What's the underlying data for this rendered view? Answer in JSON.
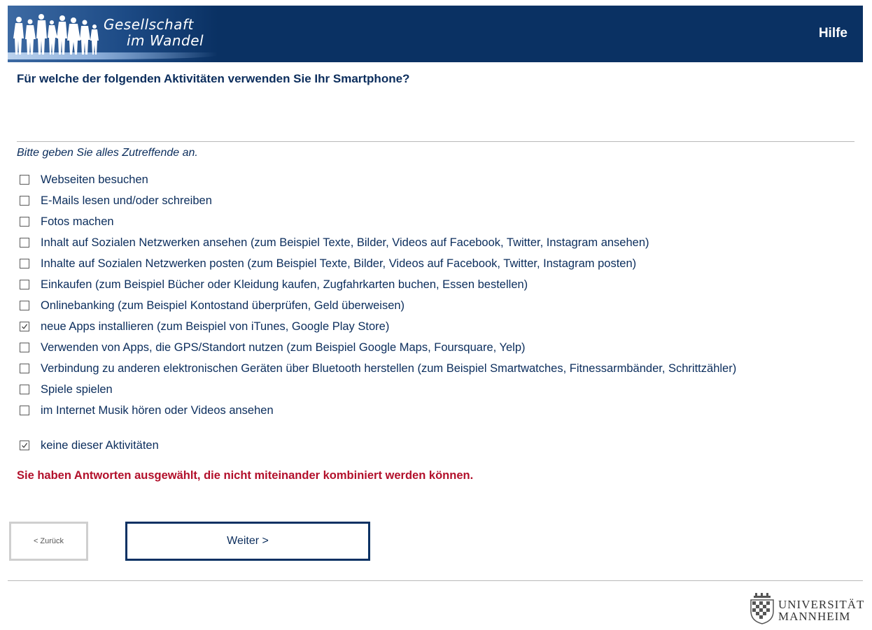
{
  "header": {
    "logo_line1": "Gesellschaft",
    "logo_line2": "im Wandel",
    "help_label": "Hilfe",
    "background_color": "#0a3163"
  },
  "question": {
    "title": "Für welche der folgenden Aktivitäten verwenden Sie Ihr Smartphone?",
    "instruction": "Bitte geben Sie alles Zutreffende an."
  },
  "options": [
    {
      "label": "Webseiten besuchen",
      "checked": false
    },
    {
      "label": "E-Mails lesen und/oder schreiben",
      "checked": false
    },
    {
      "label": "Fotos machen",
      "checked": false
    },
    {
      "label": "Inhalt auf Sozialen Netzwerken ansehen (zum Beispiel Texte, Bilder, Videos auf Facebook, Twitter, Instagram ansehen)",
      "checked": false
    },
    {
      "label": "Inhalte auf Sozialen Netzwerken posten (zum Beispiel Texte, Bilder, Videos auf Facebook, Twitter, Instagram posten)",
      "checked": false
    },
    {
      "label": "Einkaufen (zum Beispiel Bücher oder Kleidung kaufen, Zugfahrkarten buchen, Essen bestellen)",
      "checked": false
    },
    {
      "label": "Onlinebanking (zum Beispiel Kontostand überprüfen, Geld überweisen)",
      "checked": false
    },
    {
      "label": "neue Apps installieren (zum Beispiel von iTunes, Google Play Store)",
      "checked": true
    },
    {
      "label": "Verwenden von Apps, die GPS/Standort nutzen (zum Beispiel Google Maps, Foursquare, Yelp)",
      "checked": false
    },
    {
      "label": "Verbindung zu anderen elektronischen Geräten über Bluetooth herstellen (zum Beispiel Smartwatches, Fitnessarmbänder, Schrittzähler)",
      "checked": false
    },
    {
      "label": "Spiele spielen",
      "checked": false
    },
    {
      "label": "im Internet Musik hören oder Videos ansehen",
      "checked": false
    },
    {
      "label": "keine dieser Aktivitäten",
      "checked": true
    }
  ],
  "error_message": "Sie haben Antworten ausgewählt, die nicht miteinander kombiniert werden können.",
  "navigation": {
    "back_label": "< Zurück",
    "next_label": "Weiter >"
  },
  "footer": {
    "university_line1": "UNIVERSITÄT",
    "university_line2": "MANNHEIM"
  },
  "colors": {
    "primary": "#0a3163",
    "text": "#0b2d5c",
    "error": "#b2102b"
  },
  "icons": {
    "logo": "people-silhouettes-icon",
    "checkbox_checked": "checkmark-icon",
    "crest": "university-crest-icon"
  }
}
